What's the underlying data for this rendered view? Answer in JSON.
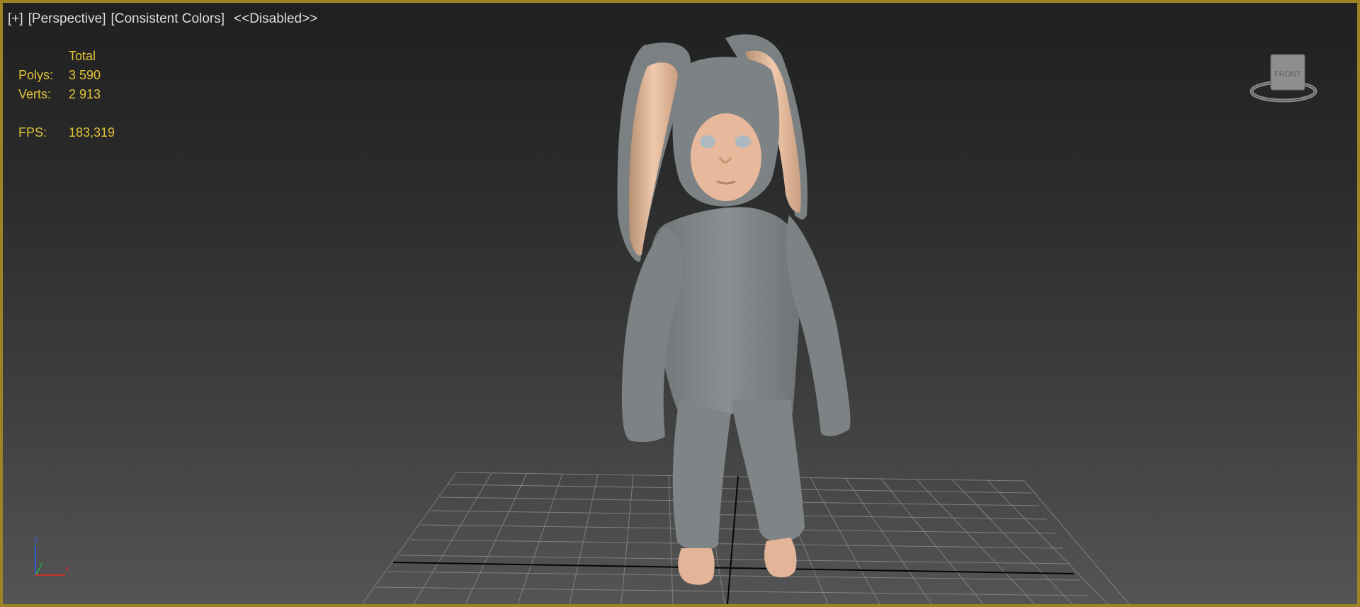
{
  "viewport": {
    "menu": {
      "plus": "[+]",
      "view": "[Perspective]",
      "shading": "[Consistent Colors]",
      "mode": "<<Disabled>>"
    },
    "stats": {
      "column_header": "Total",
      "polys_label": "Polys:",
      "polys_value": "3 590",
      "verts_label": "Verts:",
      "verts_value": "2 913",
      "fps_label": "FPS:",
      "fps_value": "183,319"
    },
    "viewcube": {
      "face_label": "FRONT"
    },
    "axis_gizmo": {
      "z": "z",
      "y": "y",
      "x": "x"
    },
    "model": {
      "icon": "bunny-suit-child-model"
    },
    "colors": {
      "border": "#9c8424",
      "stats_text": "#e0c338",
      "suit": "#7f8486",
      "skin": "#e3b497",
      "grid": "#8c8c8c"
    }
  }
}
